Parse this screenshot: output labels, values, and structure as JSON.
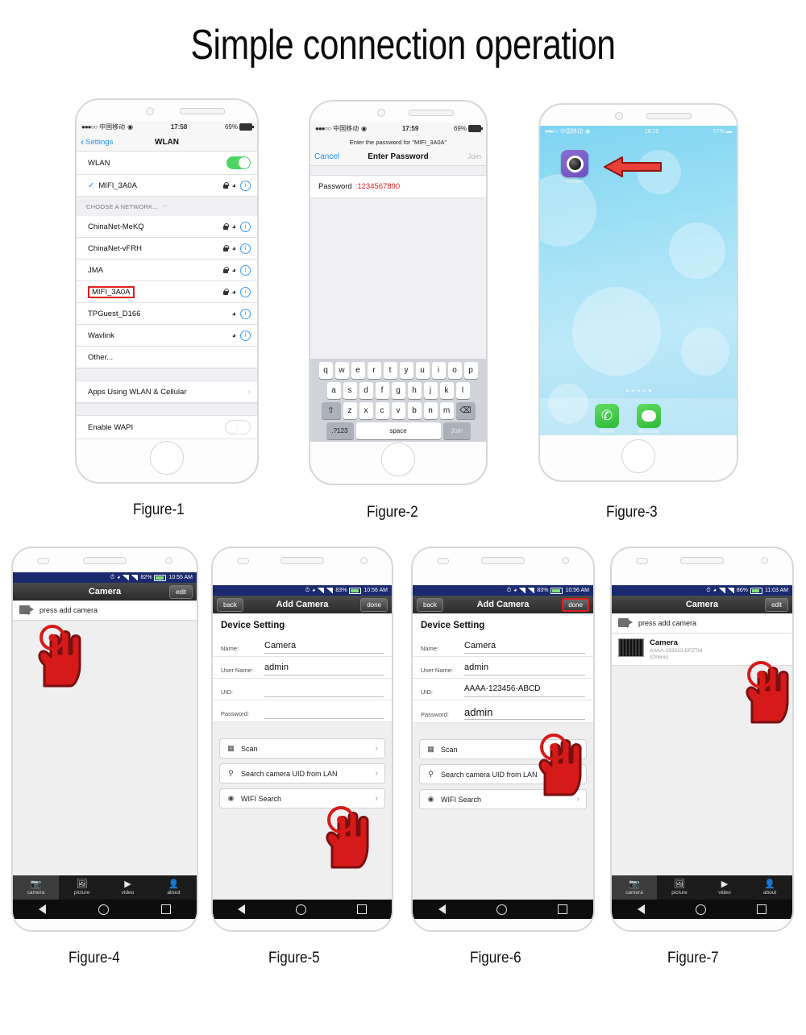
{
  "title": "Simple connection operation",
  "captions": {
    "fig1": "Figure-1",
    "fig2": "Figure-2",
    "fig3": "Figure-3",
    "fig4": "Figure-4",
    "fig5": "Figure-5",
    "fig6": "Figure-6",
    "fig7": "Figure-7"
  },
  "colors": {
    "accent_red": "#e02020",
    "ios_blue": "#1e8cf0",
    "toggle_green": "#4cd562",
    "android_status_blue": "#1a2a6e"
  },
  "figure1": {
    "status": {
      "dots": "●●●○○",
      "carrier": "中国移动",
      "time": "17:58",
      "battery": "69%"
    },
    "nav": {
      "back": "Settings",
      "title": "WLAN"
    },
    "wlan_label": "WLAN",
    "connected_network": "MIFI_3A0A",
    "section_header": "CHOOSE A NETWORK...",
    "networks": [
      {
        "name": "ChinaNet-MeKQ",
        "locked": true,
        "highlighted": false
      },
      {
        "name": "ChinaNet-vFRH",
        "locked": true,
        "highlighted": false
      },
      {
        "name": "JMA",
        "locked": true,
        "highlighted": false
      },
      {
        "name": "MIFI_3A0A",
        "locked": true,
        "highlighted": true
      },
      {
        "name": "TPGuest_D166",
        "locked": false,
        "highlighted": false
      },
      {
        "name": "Wavlink",
        "locked": false,
        "highlighted": false
      }
    ],
    "other": "Other...",
    "apps_using": "Apps Using WLAN & Cellular",
    "enable_wapi": "Enable WAPI"
  },
  "figure2": {
    "status": {
      "dots": "●●●○○",
      "carrier": "中国移动",
      "time": "17:59",
      "battery": "69%"
    },
    "prompt": "Enter the password for \"MIFI_3A0A\"",
    "nav": {
      "cancel": "Cancel",
      "title": "Enter Password",
      "join": "Join"
    },
    "password_label": "Password",
    "password_value": ":1234567890",
    "keyboard": {
      "row1": [
        "q",
        "w",
        "e",
        "r",
        "t",
        "y",
        "u",
        "i",
        "o",
        "p"
      ],
      "row2": [
        "a",
        "s",
        "d",
        "f",
        "g",
        "h",
        "j",
        "k",
        "l"
      ],
      "row3": [
        "z",
        "x",
        "c",
        "v",
        "b",
        "n",
        "m"
      ],
      "shift": "⇧",
      "backspace": "⌫",
      "numbers": ".?123",
      "space": "space",
      "join": "Join"
    }
  },
  "figure3": {
    "status": {
      "dots": "●●●○○",
      "carrier": "中国移动",
      "time": "18:28",
      "battery": "57%"
    },
    "app_label": "Camera",
    "dock": [
      {
        "label": "Phone",
        "icon": "phone-icon",
        "glyph": "✆"
      },
      {
        "label": "Messages",
        "icon": "messages-icon",
        "glyph": "💬"
      }
    ]
  },
  "figure4": {
    "status": {
      "battery": "82%",
      "time": "10:55 AM"
    },
    "nav": {
      "title": "Camera",
      "edit": "edit"
    },
    "add_row": "press add camera",
    "tabs": [
      {
        "label": "camera",
        "icon": "camera-icon",
        "active": true
      },
      {
        "label": "picture",
        "icon": "picture-icon",
        "active": false
      },
      {
        "label": "video",
        "icon": "video-icon",
        "active": false
      },
      {
        "label": "about",
        "icon": "about-icon",
        "active": false
      }
    ]
  },
  "figure5": {
    "status": {
      "battery": "83%",
      "time": "10:56 AM"
    },
    "nav": {
      "back": "back",
      "title": "Add Camera",
      "done": "done"
    },
    "section_title": "Device Setting",
    "fields": [
      {
        "label": "Name:",
        "value": "Camera"
      },
      {
        "label": "User Name:",
        "value": "admin"
      },
      {
        "label": "UID:",
        "value": ""
      },
      {
        "label": "Password:",
        "value": ""
      }
    ],
    "menu": [
      {
        "label": "Scan",
        "icon": "qr-scan-icon"
      },
      {
        "label": "Search camera UID from LAN",
        "icon": "search-icon"
      },
      {
        "label": "WIFI Search",
        "icon": "wifi-icon"
      }
    ]
  },
  "figure6": {
    "status": {
      "battery": "83%",
      "time": "10:56 AM"
    },
    "nav": {
      "back": "back",
      "title": "Add Camera",
      "done": "done"
    },
    "section_title": "Device Setting",
    "fields": [
      {
        "label": "Name:",
        "value": "Camera"
      },
      {
        "label": "User Name:",
        "value": "admin"
      },
      {
        "label": "UID:",
        "value": "AAAA-123456-ABCD"
      },
      {
        "label": "Password:",
        "value": "admin"
      }
    ],
    "menu": [
      {
        "label": "Scan",
        "icon": "qr-scan-icon"
      },
      {
        "label": "Search camera UID from LAN",
        "icon": "search-icon"
      },
      {
        "label": "WIFI Search",
        "icon": "wifi-icon"
      }
    ]
  },
  "figure7": {
    "status": {
      "battery": "86%",
      "time": "11:03 AM"
    },
    "nav": {
      "title": "Camera",
      "edit": "edit"
    },
    "add_row": "press add camera",
    "camera": {
      "name": "Camera",
      "uid": "AAAA-193533-DFZTM",
      "status": "(Online)"
    },
    "tabs": [
      {
        "label": "camera",
        "icon": "camera-icon",
        "active": true
      },
      {
        "label": "picture",
        "icon": "picture-icon",
        "active": false
      },
      {
        "label": "video",
        "icon": "video-icon",
        "active": false
      },
      {
        "label": "about",
        "icon": "about-icon",
        "active": false
      }
    ]
  }
}
